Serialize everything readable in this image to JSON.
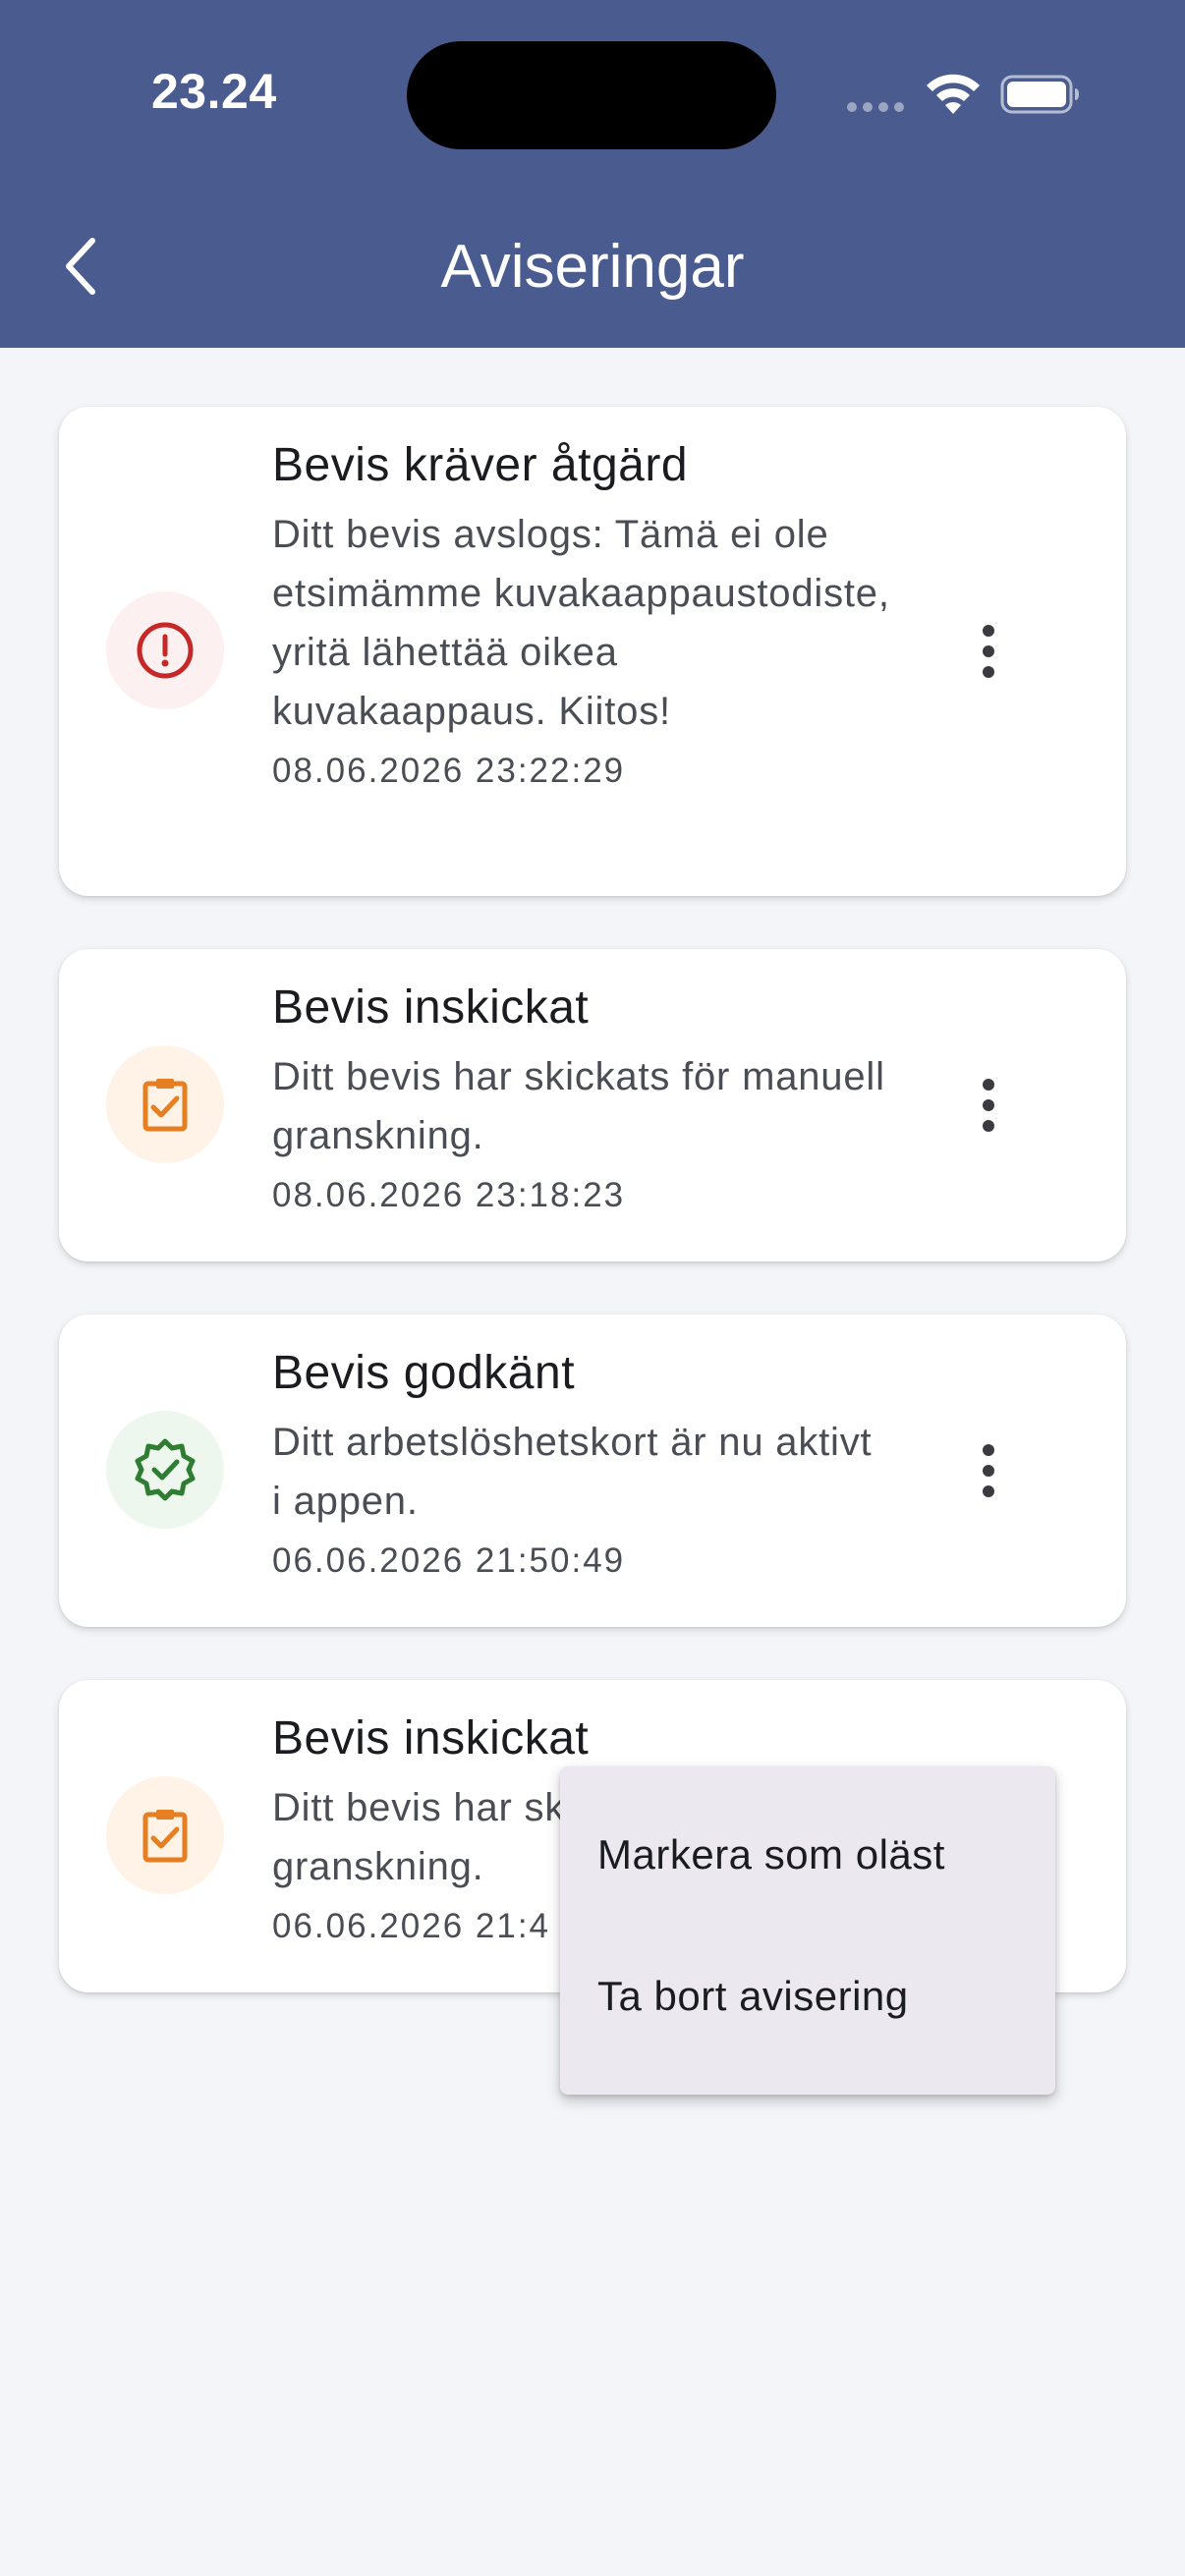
{
  "status_bar": {
    "time": "23.24",
    "icons": [
      "cellular-dots-icon",
      "wifi-icon",
      "battery-icon"
    ]
  },
  "header": {
    "back_icon": "chevron-left-icon",
    "title": "Aviseringar"
  },
  "notifications": [
    {
      "icon": "exclamation-circle-icon",
      "icon_color": "#c62828",
      "title": "Bevis kräver åtgärd",
      "message": "Ditt bevis avslogs: Tämä ei ole etsimämme kuvakaappaustodiste, yritä lähettää oikea kuvakaappaus. Kiitos!",
      "timestamp": "08.06.2026 23:22:29",
      "more_icon": "more-vertical-icon"
    },
    {
      "icon": "clipboard-check-icon",
      "icon_color": "#e67e22",
      "title": "Bevis inskickat",
      "message": "Ditt bevis har skickats för manuell granskning.",
      "timestamp": "08.06.2026 23:18:23",
      "more_icon": "more-vertical-icon"
    },
    {
      "icon": "verified-badge-icon",
      "icon_color": "#2e7d32",
      "title": "Bevis godkänt",
      "message": "Ditt arbetslöshetskort är nu aktivt i appen.",
      "timestamp": "06.06.2026 21:50:49",
      "more_icon": "more-vertical-icon"
    },
    {
      "icon": "clipboard-check-icon",
      "icon_color": "#e67e22",
      "title": "Bevis inskickat",
      "message": "Ditt bevis har skickats för manuell granskning.",
      "timestamp": "06.06.2026 21:4",
      "more_icon": "more-vertical-icon"
    }
  ],
  "context_menu": {
    "items": [
      "Markera som oläst",
      "Ta bort avisering"
    ]
  },
  "colors": {
    "header_bg": "#4a5b8f",
    "page_bg": "#f4f5f8",
    "menu_bg": "#ebe9ef"
  }
}
